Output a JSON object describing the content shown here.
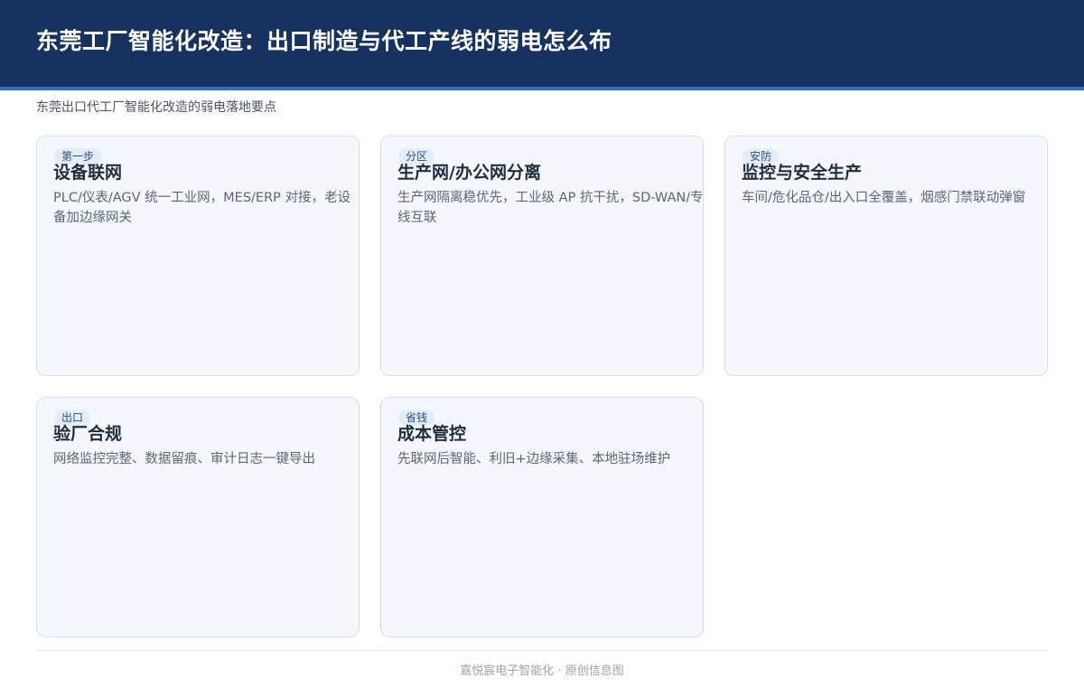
{
  "header": {
    "title": "东莞工厂智能化改造：出口制造与代工产线的弱电怎么布"
  },
  "subtitle": "东莞出口代工厂智能化改造的弱电落地要点",
  "cards": [
    {
      "badge": "第一步",
      "title": "设备联网",
      "desc": "PLC/仪表/AGV 统一工业网，MES/ERP 对接，老设备加边缘网关"
    },
    {
      "badge": "分区",
      "title": "生产网/办公网分离",
      "desc": "生产网隔离稳优先，工业级 AP 抗干扰，SD-WAN/专线互联"
    },
    {
      "badge": "安防",
      "title": "监控与安全生产",
      "desc": "车间/危化品仓/出入口全覆盖，烟感门禁联动弹窗"
    },
    {
      "badge": "出口",
      "title": "验厂合规",
      "desc": "网络监控完整、数据留痕、审计日志一键导出"
    },
    {
      "badge": "省钱",
      "title": "成本管控",
      "desc": "先联网后智能、利旧+边缘采集、本地驻场维护"
    }
  ],
  "footer": "嘉悦宸电子智能化 · 原创信息图",
  "colors": {
    "header_bg": "#17325e",
    "accent": "#2f6fc4",
    "card_bg": "#f4f8fc",
    "card_border": "#d3e0ef"
  }
}
